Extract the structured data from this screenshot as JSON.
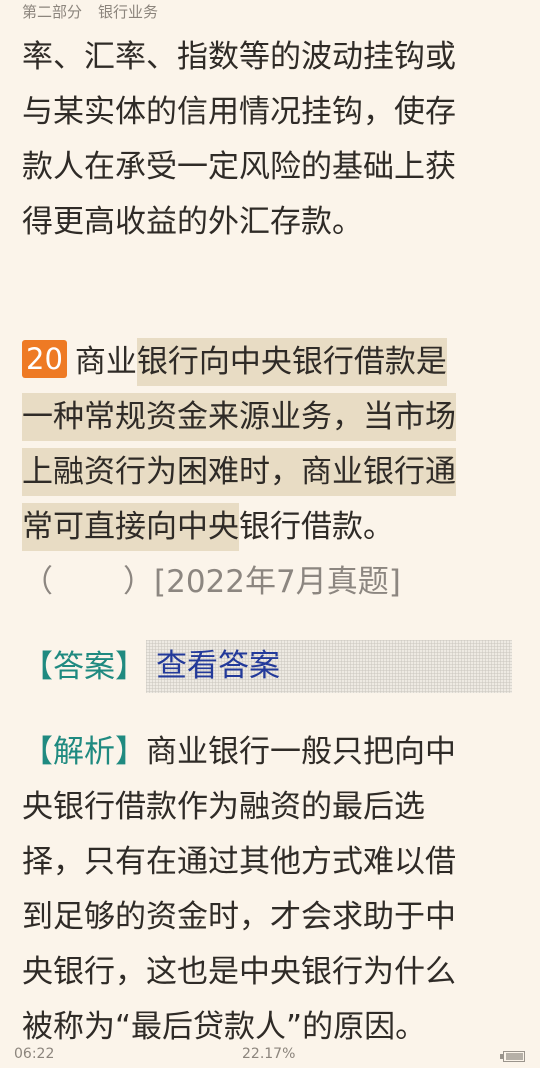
{
  "header": {
    "part": "第二部分",
    "section": "银行业务"
  },
  "paragraph_prev": {
    "lines": [
      "率、汇率、指数等的波动挂钩或",
      "与某实体的信用情况挂钩，使存",
      "款人在承受一定风险的基础上获",
      "得更高收益的外汇存款。"
    ]
  },
  "question": {
    "number": "20",
    "line1_plain": "商业",
    "line1_hl": "银行向中央银行借款是",
    "line2_hl": "一种常规资金来源业务，当市场",
    "line3_hl": "上融资行为困难时，商业银行通",
    "line4_hl": "常可直接向中央",
    "line4_plain": "银行借款。",
    "paren_open": "（",
    "paren_close": "）",
    "source": "[2022年7月真题]"
  },
  "answer": {
    "label": "【答案】",
    "link_text": "查看答案"
  },
  "analysis": {
    "label": "【解析】",
    "line1_text": "商业银行一般只把向中",
    "lines": [
      "央银行借款作为融资的最后选",
      "择，只有在通过其他方式难以借",
      "到足够的资金时，才会求助于中",
      "央银行，这也是中央银行为什么",
      "被称为“最后贷款人”的原因。"
    ]
  },
  "status": {
    "time": "06:22",
    "progress": "22.17%",
    "battery_icon": "battery-icon"
  }
}
